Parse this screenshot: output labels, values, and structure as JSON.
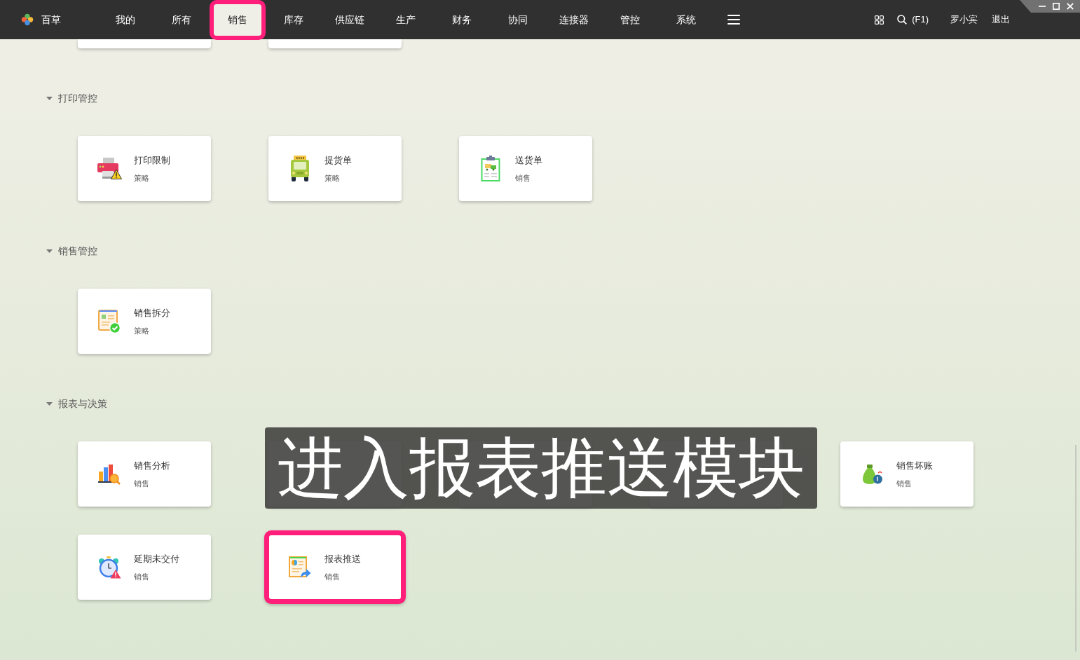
{
  "app": {
    "name": "百草"
  },
  "nav_tabs": [
    {
      "label": "我的",
      "selected": false,
      "highlighted": false
    },
    {
      "label": "所有",
      "selected": false,
      "highlighted": false
    },
    {
      "label": "销售",
      "selected": true,
      "highlighted": true
    },
    {
      "label": "库存",
      "selected": false,
      "highlighted": false
    },
    {
      "label": "供应链",
      "selected": false,
      "highlighted": false
    },
    {
      "label": "生产",
      "selected": false,
      "highlighted": false
    },
    {
      "label": "财务",
      "selected": false,
      "highlighted": false
    },
    {
      "label": "协同",
      "selected": false,
      "highlighted": false
    },
    {
      "label": "连接器",
      "selected": false,
      "highlighted": false
    },
    {
      "label": "管控",
      "selected": false,
      "highlighted": false
    },
    {
      "label": "系统",
      "selected": false,
      "highlighted": false
    }
  ],
  "header_right": {
    "search_hint": "(F1)",
    "user": "罗小宾",
    "logout": "退出"
  },
  "sections": [
    {
      "items": [
        {
          "kind": "clipped"
        },
        {
          "kind": "clipped"
        }
      ]
    },
    {
      "title": "打印管控",
      "expanded": true,
      "items": [
        {
          "kind": "card",
          "title": "打印限制",
          "subtitle": "策略",
          "highlighted": false
        },
        {
          "kind": "card",
          "title": "提货单",
          "subtitle": "策略",
          "highlighted": false
        },
        {
          "kind": "card",
          "title": "送货单",
          "subtitle": "销售",
          "highlighted": false
        }
      ]
    },
    {
      "title": "销售管控",
      "expanded": true,
      "items": [
        {
          "kind": "card",
          "title": "销售拆分",
          "subtitle": "策略",
          "highlighted": false
        }
      ]
    },
    {
      "title": "报表与决策",
      "expanded": true,
      "items": [
        {
          "kind": "card",
          "title": "销售分析",
          "subtitle": "销售",
          "highlighted": false
        },
        {
          "kind": "covered"
        },
        {
          "kind": "covered"
        },
        {
          "kind": "covered"
        },
        {
          "kind": "card",
          "title": "销售坏账",
          "subtitle": "销售",
          "highlighted": false
        },
        {
          "kind": "card",
          "title": "延期未交付",
          "subtitle": "销售",
          "highlighted": false
        },
        {
          "kind": "card",
          "title": "报表推送",
          "subtitle": "销售",
          "highlighted": true
        }
      ]
    }
  ],
  "caption": {
    "text": "进入报表推送模块"
  }
}
